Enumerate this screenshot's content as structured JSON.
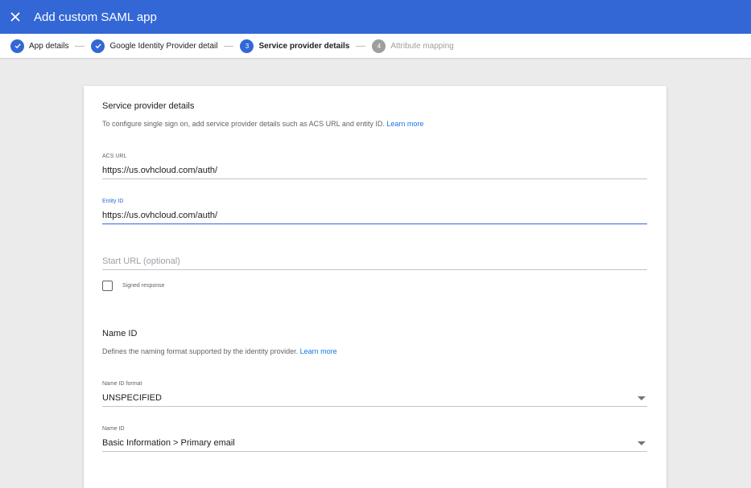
{
  "header": {
    "title": "Add custom SAML app",
    "close_icon": "close-icon"
  },
  "stepper": {
    "steps": [
      {
        "label": "App details",
        "state": "done",
        "number": ""
      },
      {
        "label": "Google Identity Provider details",
        "state": "done",
        "number": ""
      },
      {
        "label": "Service provider details",
        "state": "active",
        "number": "3"
      },
      {
        "label": "Attribute mapping",
        "state": "inactive",
        "number": "4"
      }
    ]
  },
  "service_provider": {
    "title": "Service provider details",
    "description": "To configure single sign on, add service provider details such as ACS URL and entity ID.",
    "learn_more": "Learn more",
    "acs_url": {
      "label": "ACS URL",
      "value": "https://us.ovhcloud.com/auth/"
    },
    "entity_id": {
      "label": "Entity ID",
      "value": "https://us.ovhcloud.com/auth/"
    },
    "start_url": {
      "placeholder": "Start URL (optional)"
    },
    "signed_response": {
      "label": "Signed response",
      "checked": false
    }
  },
  "name_id": {
    "title": "Name ID",
    "description": "Defines the naming format supported by the identity provider.",
    "learn_more": "Learn more",
    "format": {
      "label": "Name ID format",
      "value": "UNSPECIFIED"
    },
    "name_id_field": {
      "label": "Name ID",
      "value": "Basic Information > Primary email"
    }
  },
  "colors": {
    "accent": "#3367d6",
    "link": "#1a73e8"
  }
}
